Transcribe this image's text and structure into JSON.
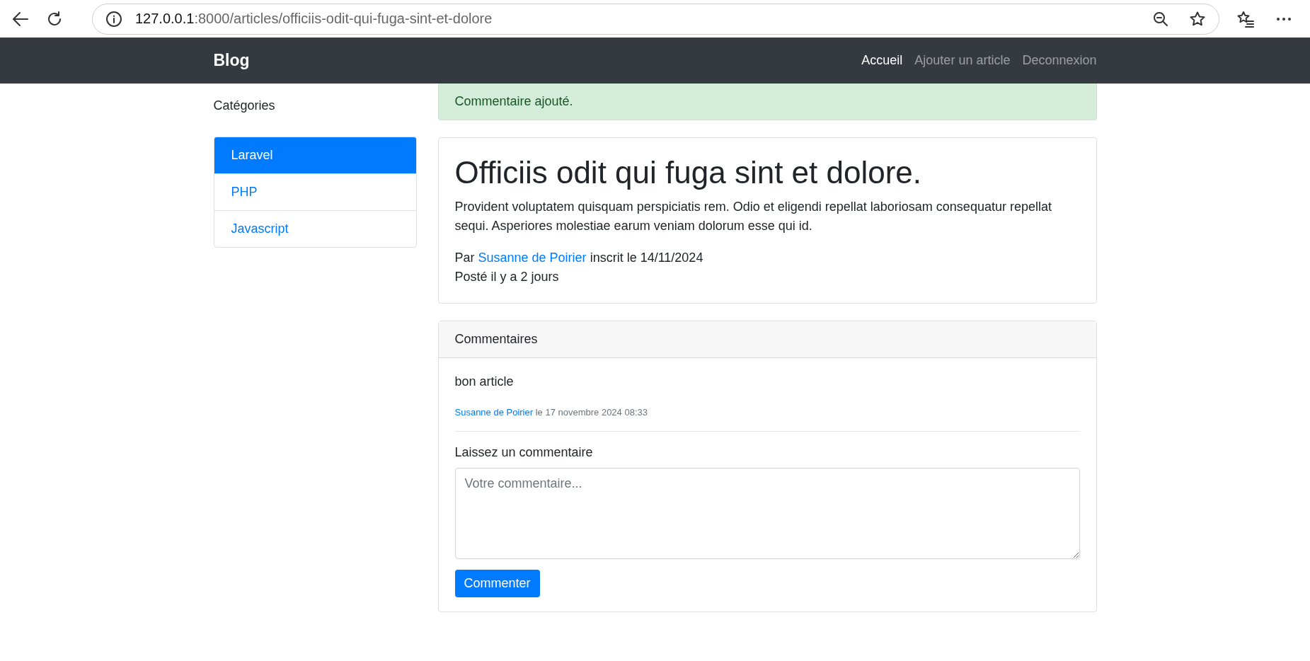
{
  "browser": {
    "url_host": "127.0.0.1",
    "url_path": ":8000/articles/officiis-odit-qui-fuga-sint-et-dolore"
  },
  "navbar": {
    "brand": "Blog",
    "links": [
      {
        "label": "Accueil",
        "selected": true
      },
      {
        "label": "Ajouter un article",
        "selected": false
      },
      {
        "label": "Deconnexion",
        "selected": false
      }
    ]
  },
  "sidebar": {
    "title": "Catégories",
    "items": [
      {
        "label": "Laravel",
        "selected": true
      },
      {
        "label": "PHP",
        "selected": false
      },
      {
        "label": "Javascript",
        "selected": false
      }
    ]
  },
  "alert": "Commentaire ajouté.",
  "article": {
    "title": "Officiis odit qui fuga sint et dolore.",
    "body": "Provident voluptatem quisquam perspiciatis rem. Odio et eligendi repellat laboriosam consequatur repellat sequi. Asperiores molestiae earum veniam dolorum esse qui id.",
    "byline": {
      "prefix": "Par",
      "author": "Susanne de Poirier",
      "suffix": "inscrit le 14/11/2024"
    },
    "posted": "Posté il y a 2 jours"
  },
  "comments": {
    "header": "Commentaires",
    "items": [
      {
        "text": "bon article",
        "author": "Susanne de Poirier",
        "date": "le 17 novembre 2024 08:33"
      }
    ],
    "form": {
      "label": "Laissez un commentaire",
      "placeholder": "Votre commentaire...",
      "button": "Commenter"
    }
  }
}
